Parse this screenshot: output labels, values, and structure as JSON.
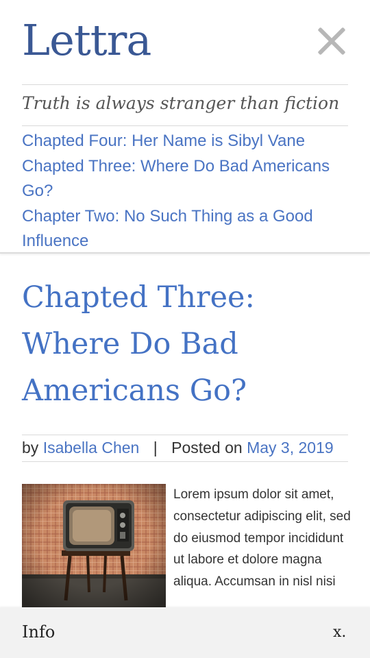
{
  "header": {
    "site_title": "Lettra",
    "tagline": "Truth is always stranger than fiction"
  },
  "recent_posts": [
    "Chapted Four: Her Name is Sibyl Vane",
    "Chapted Three: Where Do Bad Americans Go?",
    "Chapter Two: No Such Thing as a Good Influence"
  ],
  "post": {
    "title": "Chapted Three: Where Do Bad Americans Go?",
    "by_label": "by",
    "author": "Isabella Chen",
    "separator": "|",
    "posted_label": "Posted on",
    "date": "May 3, 2019",
    "excerpt": "Lorem ipsum dolor sit amet, consectetur adipiscing elit, sed do eiusmod tempor incididunt ut labore et dolore magna aliqua. Accumsan in nisl nisi"
  },
  "info_bar": {
    "label": "Info",
    "close": "x."
  },
  "colors": {
    "link": "#4a74c3",
    "title": "#3a5894",
    "info_bar_bg": "#f2f2f2"
  },
  "icons": {
    "menu_close": "close-icon"
  }
}
